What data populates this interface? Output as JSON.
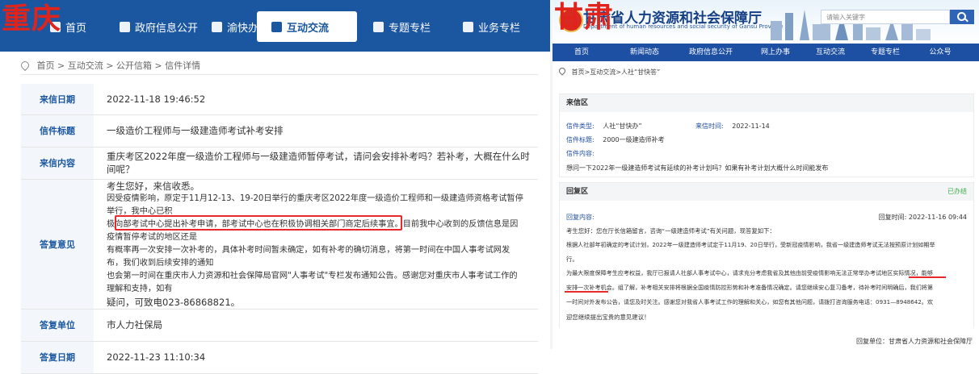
{
  "left": {
    "tag": "重庆",
    "nav": {
      "home": "首页",
      "items": [
        "政府信息公开",
        "渝快办",
        "互动交流",
        "专题专栏",
        "业务专栏"
      ]
    },
    "breadcrumb": "首页 > 互动交流 > 公开信箱 > 信件详情",
    "letter": {
      "date_label": "来信日期",
      "date_value": "2022-11-18 19:46:52",
      "title_label": "信件标题",
      "title_value": "一级造价工程师与一级建造师考试补考安排",
      "content_label": "来信内容",
      "content_value": "重庆考区2022年度一级造价工程师与一级建造师暂停考试，请问会安排补考吗？若补考，大概在什么时间呢？",
      "reply_label": "答复意见",
      "reply_lines": [
        "考生您好，来信收悉。",
        "因受疫情影响，原定于11月12-13、19-20日举行的重庆考区2022年度一级造价工程师和一级建造师资格考试暂停举行，我中心已积",
        "极向部考试中心提出补考申请，部考试中心也在积极协调相关部门商定后续事宜。目前我中心收到的反馈信息是因疫情暂停考试的地区还是",
        "有概率再一次安排一次补考的，具体补考时间暂未确定，如有补考的确切消息，将第一时间在中国人事考试网发布，我们收到后续安排的通知",
        "也会第一时间在重庆市人力资源和社会保障局官网\"人事考试\"专栏发布通知公告。感谢您对重庆市人事考试工作的理解和支持，如有",
        "疑问，可致电023-86868821。"
      ],
      "unit_label": "答复单位",
      "unit_value": "市人力社保局",
      "reply_date_label": "答复日期",
      "reply_date_value": "2022-11-23 11:10:34"
    }
  },
  "right": {
    "tag": "甘肃",
    "site_title": "甘肃省人力资源和社会保障厅",
    "site_subtitle": "Department of human resources and social security of Gansu Province",
    "search_placeholder": "请输入关键字",
    "nav": [
      "首页",
      "新闻动态",
      "政府信息公开",
      "网上办事",
      "互动交流",
      "专题专栏",
      "公众号"
    ],
    "breadcrumb": "首页>互动交流>人社“甘快答”",
    "incoming": {
      "head": "来信区",
      "type_label": "信件类型:",
      "type_value": "人社“甘快办”",
      "time_label": "来信时间:",
      "time_value": "2022-11-14",
      "title_label": "信件标题:",
      "title_value": "2000一级建造师补考",
      "content_label": "信件内容:",
      "content_value": "想问一下2022年一级建造师考试有延续的补考计划吗？如果有补考计划大概什么时间能发布"
    },
    "reply": {
      "head": "回复区",
      "status": "已办结",
      "content_label": "回复内容:",
      "time_label": "回复时间:",
      "time_value": "2022-11-16 09:44",
      "lines": [
        "考生您好：您在厅长信箱留言，咨询“一级建造师考试”有关问题，现答复如下：",
        "根据人社部年初确定的考试计划，2022年一级建造师考试定于11月19、20日举行，受新冠疫情影响，我省一级建造师考试无法按预原计划如期举",
        "行。",
        "为最大限度保障考生应考权益，我厅已报请人社部人事考试中心，请求充分考虑我省及其他由前受疫情影响无法正常举办考试地区实际情况，能够",
        "安排一次补考机会。组了解，补考相关安排将根据全国疫情防控形势和补考准备情况确定。请您继续安心复习备考，待补考时间明确后，我们将第",
        "一时间对外发布公告，请您及时关注。感谢您对我省人事考试工作的理解和关心，如您有其他问题，请拨打咨询服务电话：0931—8948642。欢",
        "迎您继续提出宝贵的意见建议！"
      ],
      "unit": "回复单位：甘肃省人力资源和社会保障厅"
    }
  },
  "colors": {
    "cq_blue": "#1b57a0",
    "gs_blue": "#1d4fa3",
    "highlight_red": "#e8282b",
    "done_green": "#3fae49"
  }
}
